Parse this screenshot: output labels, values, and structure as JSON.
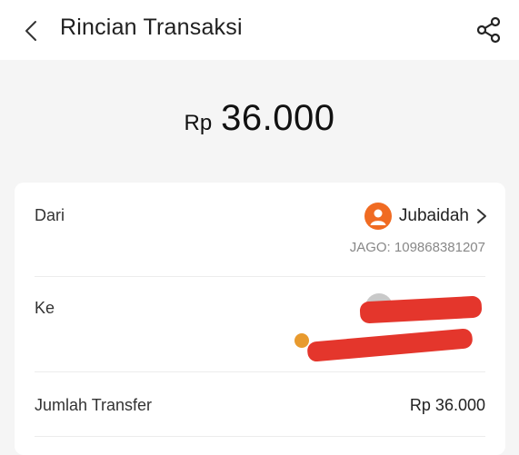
{
  "header": {
    "title": "Rincian Transaksi"
  },
  "amount": {
    "currency": "Rp",
    "value": "36.000"
  },
  "from": {
    "label": "Dari",
    "name": "Jubaidah",
    "account": "JAGO: 109868381207"
  },
  "to": {
    "label": "Ke"
  },
  "transfer": {
    "label": "Jumlah Transfer",
    "value": "Rp 36.000"
  },
  "colors": {
    "accent": "#f06b22",
    "redaction": "#e4362c"
  }
}
